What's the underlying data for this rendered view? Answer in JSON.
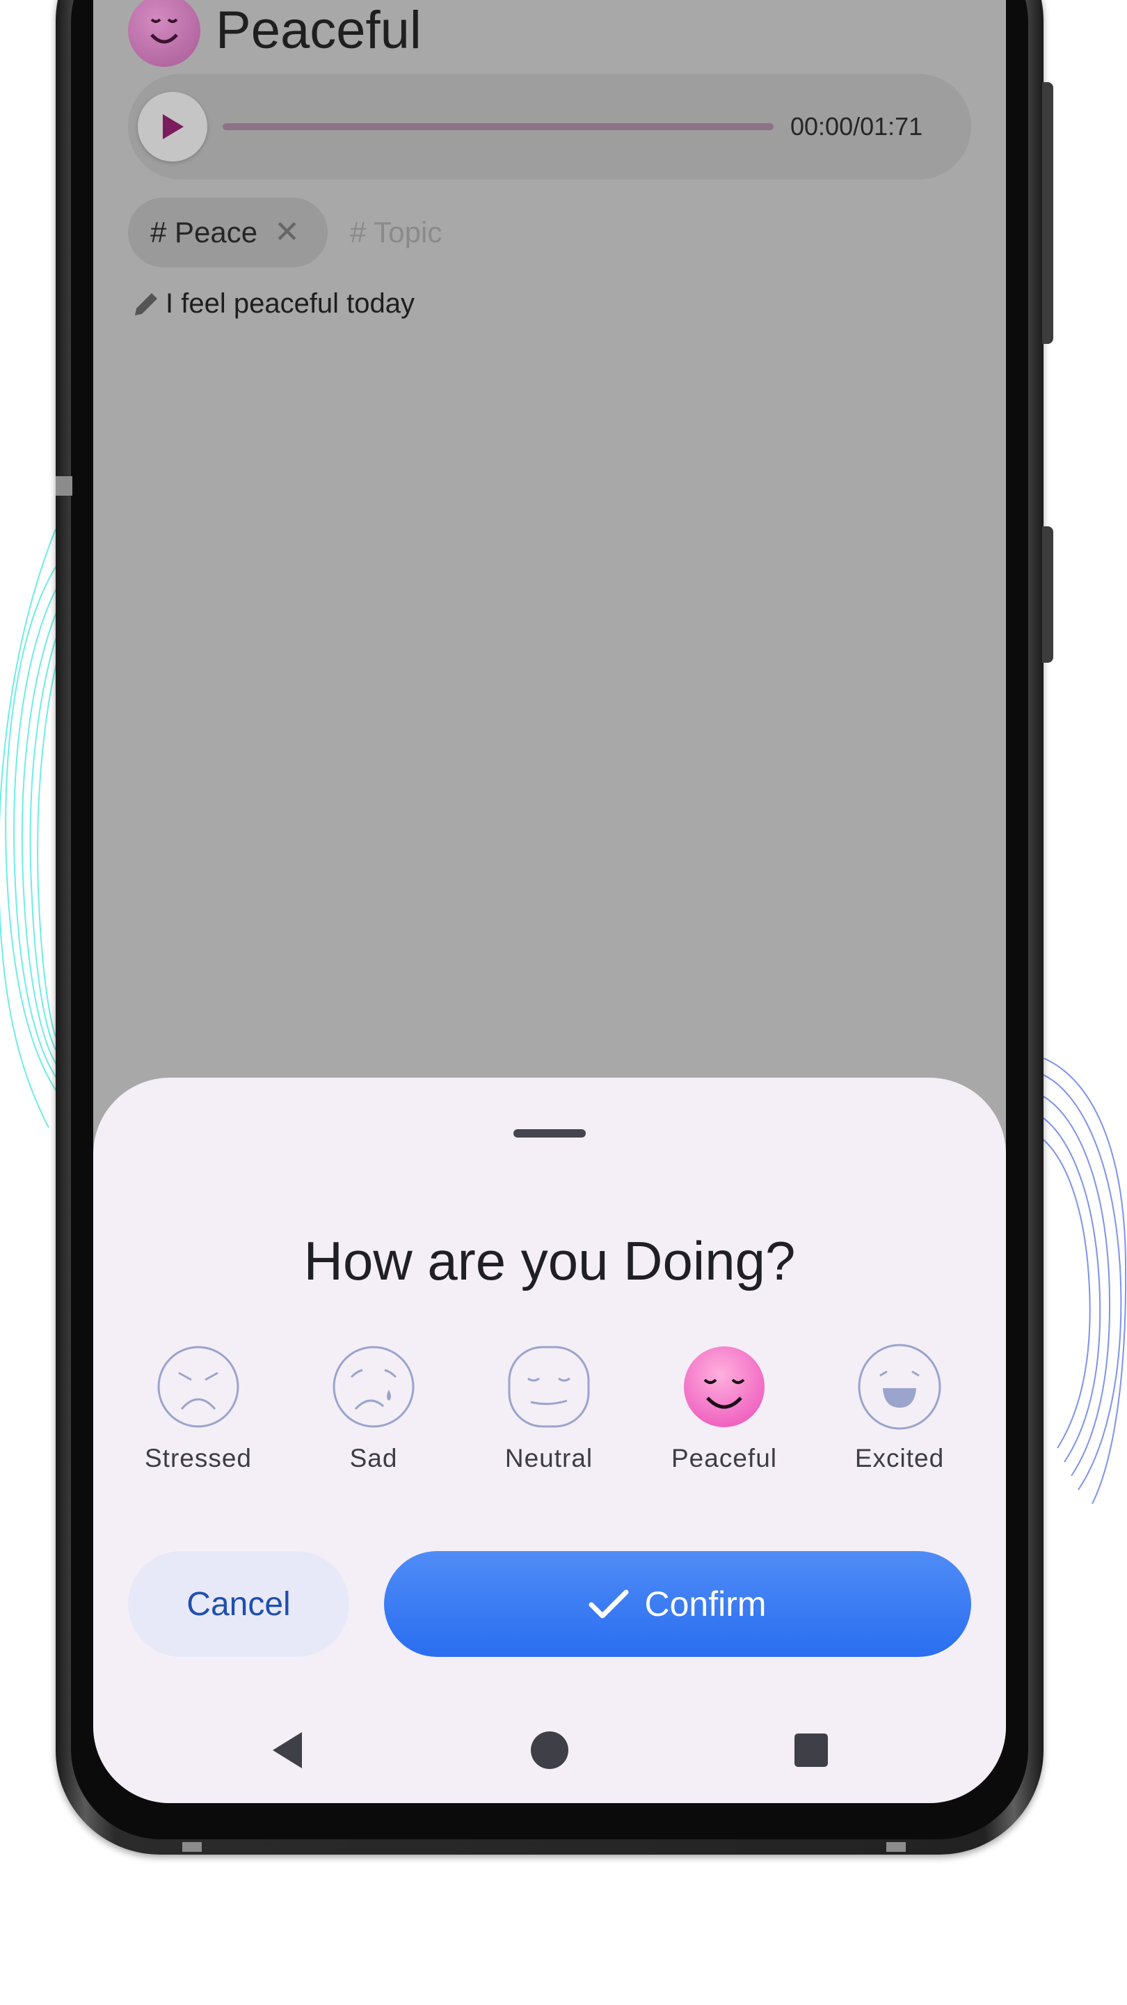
{
  "screen": {
    "mood_title": "Peaceful",
    "audio": {
      "time": "00:00/01:71",
      "progress": 0
    },
    "tags": [
      {
        "label": "# Peace"
      }
    ],
    "topic_placeholder": "# Topic",
    "note": "I feel peaceful today"
  },
  "sheet": {
    "title": "How are you Doing?",
    "moods": [
      {
        "label": "Stressed",
        "icon": "stressed-face-icon",
        "selected": false
      },
      {
        "label": "Sad",
        "icon": "sad-face-icon",
        "selected": false
      },
      {
        "label": "Neutral",
        "icon": "neutral-face-icon",
        "selected": false
      },
      {
        "label": "Peaceful",
        "icon": "peaceful-face-icon",
        "selected": true
      },
      {
        "label": "Excited",
        "icon": "excited-face-icon",
        "selected": false
      }
    ],
    "cancel_label": "Cancel",
    "confirm_label": "Confirm"
  },
  "nav": [
    "back-icon",
    "home-icon",
    "recents-icon"
  ],
  "colors": {
    "accent": "#2a6ef0",
    "selected_mood": "#f26cc8",
    "scrim": "#a8a8a8",
    "sheet_bg": "#f4eff6",
    "outline_face": "#9aa4cc"
  }
}
